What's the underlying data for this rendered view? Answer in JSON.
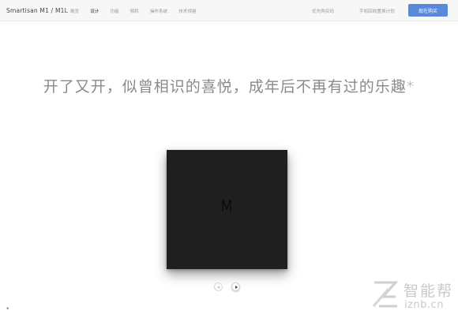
{
  "header": {
    "brand": "Smartisan M1 / M1L",
    "nav": [
      "概览",
      "设计",
      "功能",
      "相机",
      "操作系统",
      "技术规格"
    ],
    "active_nav": "设计",
    "right_links": [
      "优先购买码",
      "手机回收置换计划"
    ],
    "buy_button": "现在购买"
  },
  "main": {
    "headline": "开了又开，似曾相识的喜悦，成年后不再有过的乐趣*",
    "product_logo": "M",
    "footnote": "*"
  },
  "watermark": {
    "chinese": "智能帮",
    "url": "iznb.cn"
  },
  "colors": {
    "accent": "#5b89d9",
    "product_box": "#1f1f1f"
  }
}
